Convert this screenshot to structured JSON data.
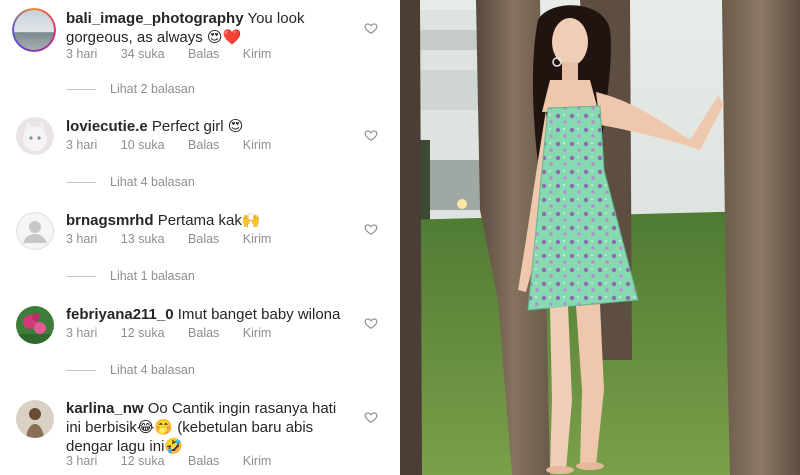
{
  "comments": [
    {
      "username": "bali_image_photography",
      "text": "You look gorgeous, as always 😍❤️",
      "time": "3 hari",
      "likes": "34 suka",
      "reply": "Balas",
      "send": "Kirim",
      "view_replies": "Lihat 2 balasan"
    },
    {
      "username": "loviecutie.e",
      "text": "Perfect girl 😍",
      "time": "3 hari",
      "likes": "10 suka",
      "reply": "Balas",
      "send": "Kirim",
      "view_replies": "Lihat 4 balasan"
    },
    {
      "username": "brnagsmrhd",
      "text": "Pertama kak🙌",
      "time": "3 hari",
      "likes": "13 suka",
      "reply": "Balas",
      "send": "Kirim",
      "view_replies": "Lihat 1 balasan"
    },
    {
      "username": "febriyana211_0",
      "text": "Imut banget baby wilona",
      "time": "3 hari",
      "likes": "12 suka",
      "reply": "Balas",
      "send": "Kirim",
      "view_replies": "Lihat 4 balasan"
    },
    {
      "username": "karlina_nw",
      "text": "Oo Cantik ingin rasanya hati ini berbisik😂🤭 (kebetulan baru abis dengar lagu ini🤣",
      "time": "3 hari",
      "likes": "12 suka",
      "reply": "Balas",
      "send": "Kirim"
    }
  ],
  "icons": {
    "like": "heart-outline-icon",
    "default_avatar": "person-silhouette-icon"
  },
  "colors": {
    "text": "#262626",
    "secondary": "#8e8e8e",
    "dress": "#7fd6a8"
  }
}
